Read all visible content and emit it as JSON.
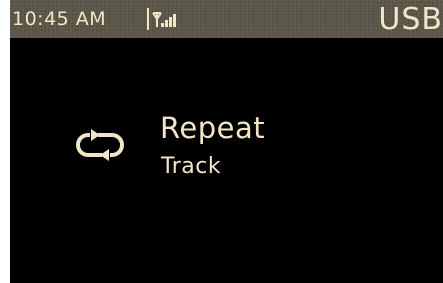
{
  "status_bar": {
    "time": "10:45 AM",
    "signal_icon": "signal-strength-icon",
    "source": "USB"
  },
  "main": {
    "icon": "repeat-icon",
    "title": "Repeat",
    "value": "Track"
  },
  "colors": {
    "text": "#f3e6c8",
    "background": "#000000",
    "status_bar_bg": "#5a5648"
  }
}
